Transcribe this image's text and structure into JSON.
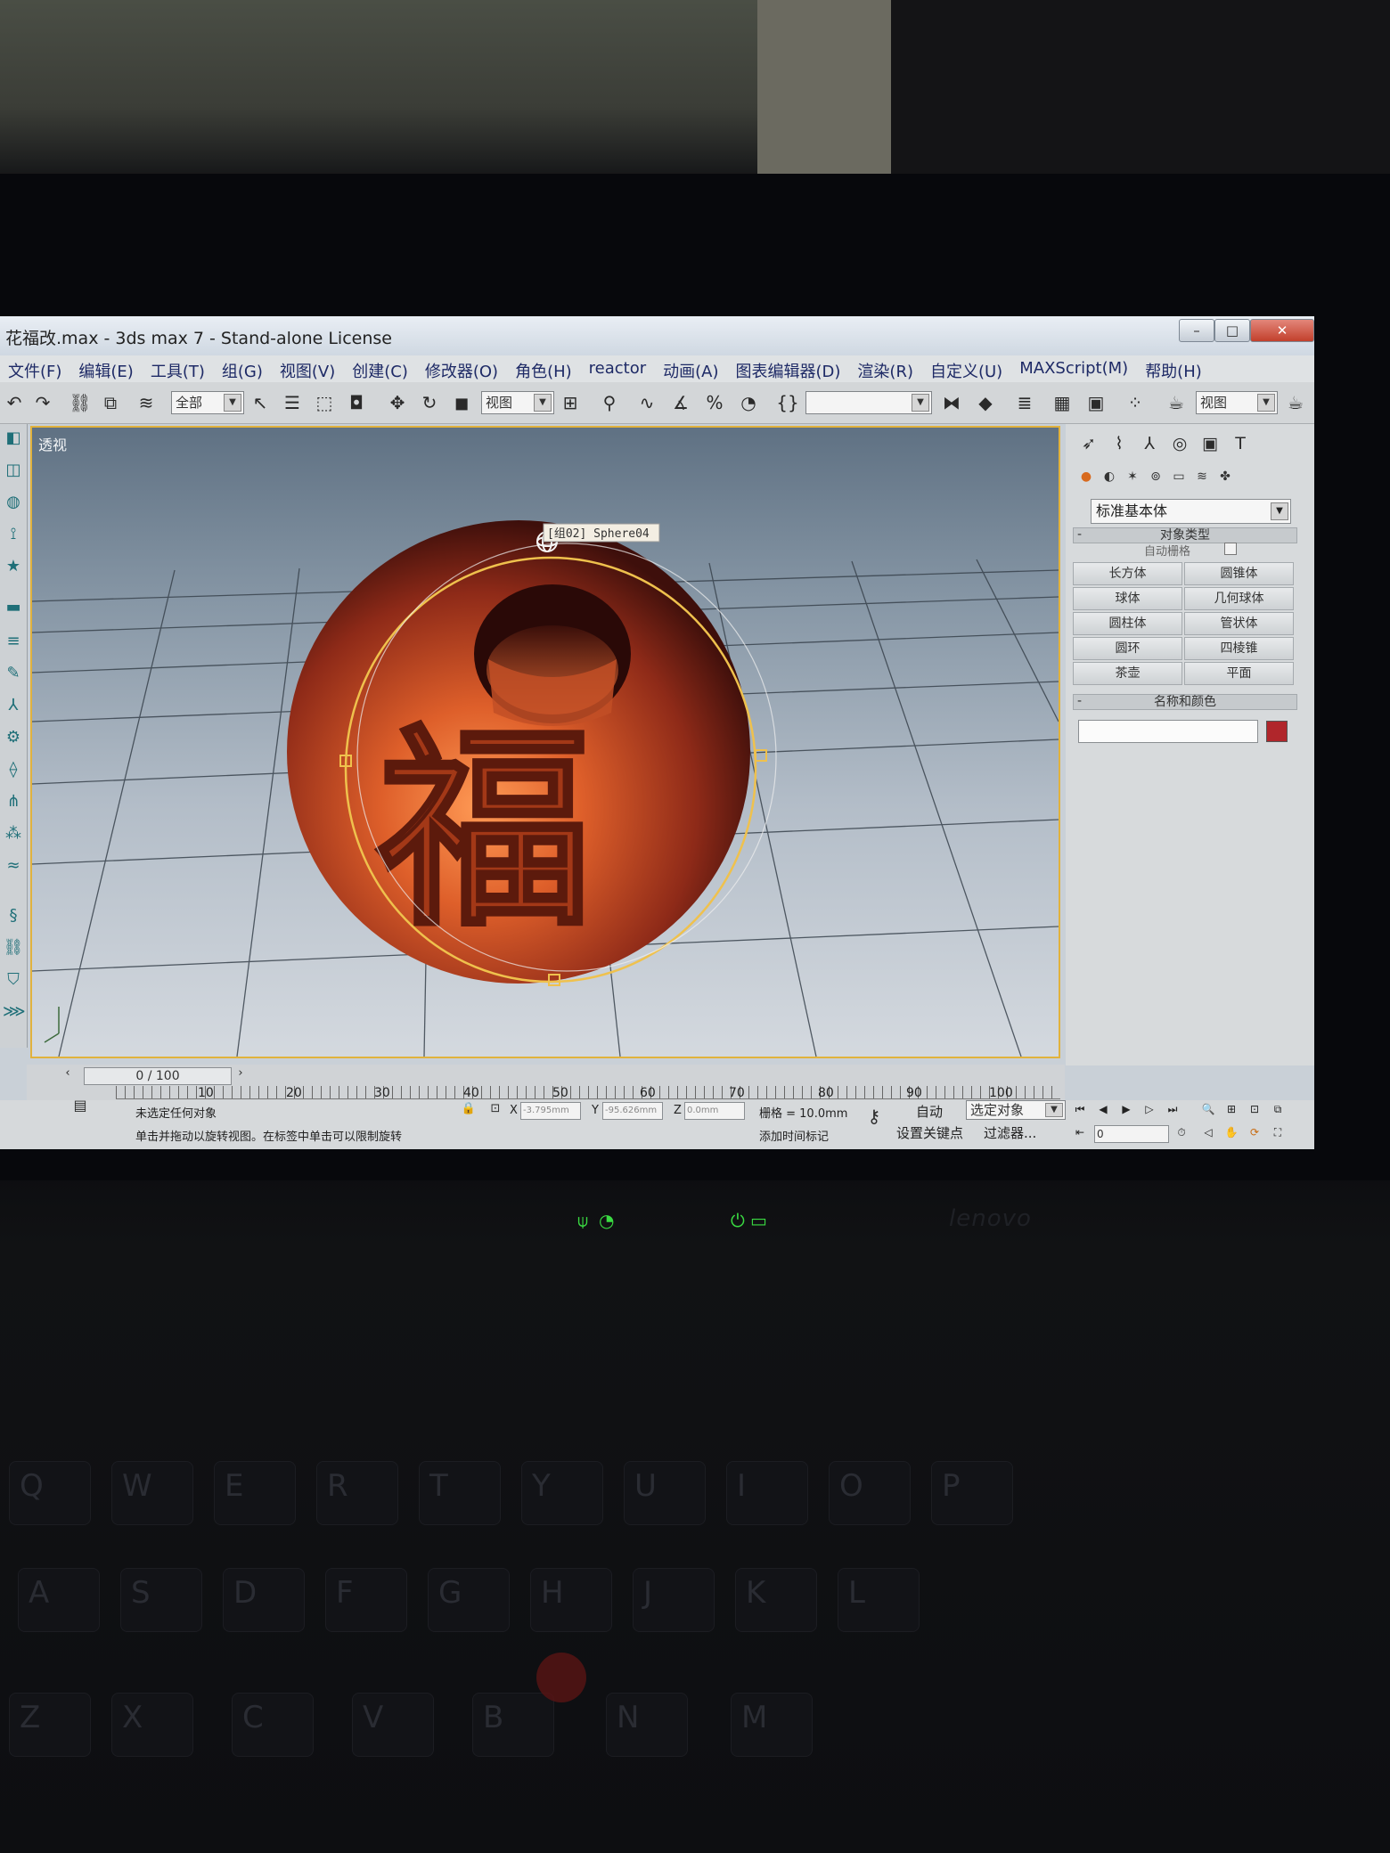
{
  "window": {
    "title": "花福改.max - 3ds max 7  - Stand-alone License",
    "minimize": "–",
    "maximize": "□",
    "close": "✕"
  },
  "menu": [
    "文件(F)",
    "编辑(E)",
    "工具(T)",
    "组(G)",
    "视图(V)",
    "创建(C)",
    "修改器(O)",
    "角色(H)",
    "reactor",
    "动画(A)",
    "图表编辑器(D)",
    "渲染(R)",
    "自定义(U)",
    "MAXScript(M)",
    "帮助(H)"
  ],
  "toolbar": {
    "selection_filter": "全部",
    "reference_coord": "视图",
    "named_selection": "",
    "render_view": "视图"
  },
  "viewport": {
    "label": "透视",
    "selection_tag": "[组02] Sphere04",
    "carved_character": "福"
  },
  "command_panel": {
    "category": "标准基本体",
    "object_type_title": "对象类型",
    "autogrid_label": "自动栅格",
    "buttons": [
      "长方体",
      "圆锥体",
      "球体",
      "几何球体",
      "圆柱体",
      "管状体",
      "圆环",
      "四棱锥",
      "茶壶",
      "平面"
    ],
    "name_color_title": "名称和颜色",
    "object_name": "",
    "object_color": "#b0262b"
  },
  "timeline": {
    "frame_counter": "0 / 100",
    "ticks": [
      "10",
      "20",
      "30",
      "40",
      "50",
      "60",
      "70",
      "80",
      "90",
      "100"
    ]
  },
  "status": {
    "selection": "未选定任何对象",
    "prompt": "单击并拖动以旋转视图。在标签中单击可以限制旋转",
    "x_label": "X",
    "x_value": "-3.795mm",
    "y_label": "Y",
    "y_value": "-95.626mm",
    "z_label": "Z",
    "z_value": "0.0mm",
    "grid": "栅格 = 10.0mm",
    "add_time_tag": "添加时间标记",
    "auto_key": "自动",
    "set_key": "设置关键点",
    "key_filter_select": "选定对象",
    "filters": "过滤器...",
    "current_frame": "0"
  },
  "laptop": {
    "brand": "lenovo",
    "keys": [
      "Q",
      "W",
      "E",
      "R",
      "T",
      "Y",
      "U",
      "I",
      "O",
      "P",
      "A",
      "S",
      "D",
      "F",
      "G",
      "H",
      "J",
      "K",
      "L",
      "Z",
      "X",
      "C",
      "V",
      "B",
      "N",
      "M"
    ]
  }
}
